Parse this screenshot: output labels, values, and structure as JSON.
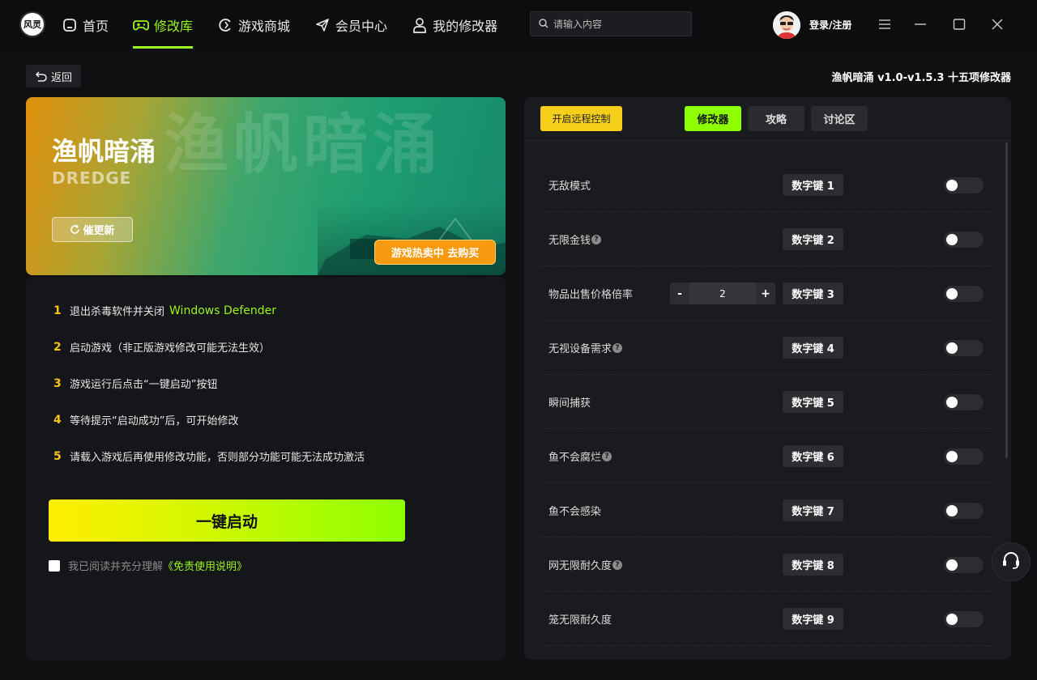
{
  "header": {
    "logo_text": "风灵",
    "nav": [
      {
        "label": "首页",
        "icon": "home-icon"
      },
      {
        "label": "修改库",
        "icon": "gamepad-icon",
        "active": true
      },
      {
        "label": "游戏商城",
        "icon": "store-icon"
      },
      {
        "label": "会员中心",
        "icon": "paper-plane-icon"
      },
      {
        "label": "我的修改器",
        "icon": "user-icon"
      }
    ],
    "search_placeholder": "请输入内容",
    "login_label": "登录/注册"
  },
  "subheader": {
    "back_label": "返回",
    "trainer_title": "渔帆暗涌 v1.0-v1.5.3 十五项修改器"
  },
  "banner": {
    "title_cn": "渔帆暗涌",
    "title_en": "DREDGE",
    "urge_label": "催更新",
    "buy_label": "游戏热卖中 去购买"
  },
  "steps": [
    {
      "num": "1",
      "text": "退出杀毒软件并关闭",
      "highlight": "Windows Defender"
    },
    {
      "num": "2",
      "text": "启动游戏（非正版游戏修改可能无法生效）"
    },
    {
      "num": "3",
      "text": "游戏运行后点击“一键启动”按钮"
    },
    {
      "num": "4",
      "text": "等待提示“启动成功”后，可开始修改"
    },
    {
      "num": "5",
      "text": "请载入游戏后再使用修改功能，否则部分功能可能无法成功激活"
    }
  ],
  "launch_label": "一键启动",
  "agree": {
    "text": "我已阅读并充分理解",
    "link": "《免责使用说明》"
  },
  "right": {
    "remote_label": "开启远程控制",
    "tabs": [
      "修改器",
      "攻略",
      "讨论区"
    ],
    "options": [
      {
        "name": "无敌模式",
        "key": "数字键 1",
        "help": false,
        "enabled": false
      },
      {
        "name": "无限金钱",
        "key": "数字键 2",
        "help": true,
        "enabled": false
      },
      {
        "name": "物品出售价格倍率",
        "key": "数字键 3",
        "help": false,
        "enabled": false,
        "stepper": {
          "minus": "-",
          "value": "2",
          "plus": "+"
        }
      },
      {
        "name": "无视设备需求",
        "key": "数字键 4",
        "help": true,
        "enabled": false
      },
      {
        "name": "瞬间捕获",
        "key": "数字键 5",
        "help": false,
        "enabled": false
      },
      {
        "name": "鱼不会腐烂",
        "key": "数字键 6",
        "help": true,
        "enabled": false
      },
      {
        "name": "鱼不会感染",
        "key": "数字键 7",
        "help": false,
        "enabled": false
      },
      {
        "name": "网无限耐久度",
        "key": "数字键 8",
        "help": true,
        "enabled": false
      },
      {
        "name": "笼无限耐久度",
        "key": "数字键 9",
        "help": false,
        "enabled": false
      }
    ],
    "help_glyph": "?"
  },
  "colors": {
    "accent_green": "#9af522",
    "accent_yellow": "#f6c31b",
    "buy_orange": "#f89a0f"
  }
}
